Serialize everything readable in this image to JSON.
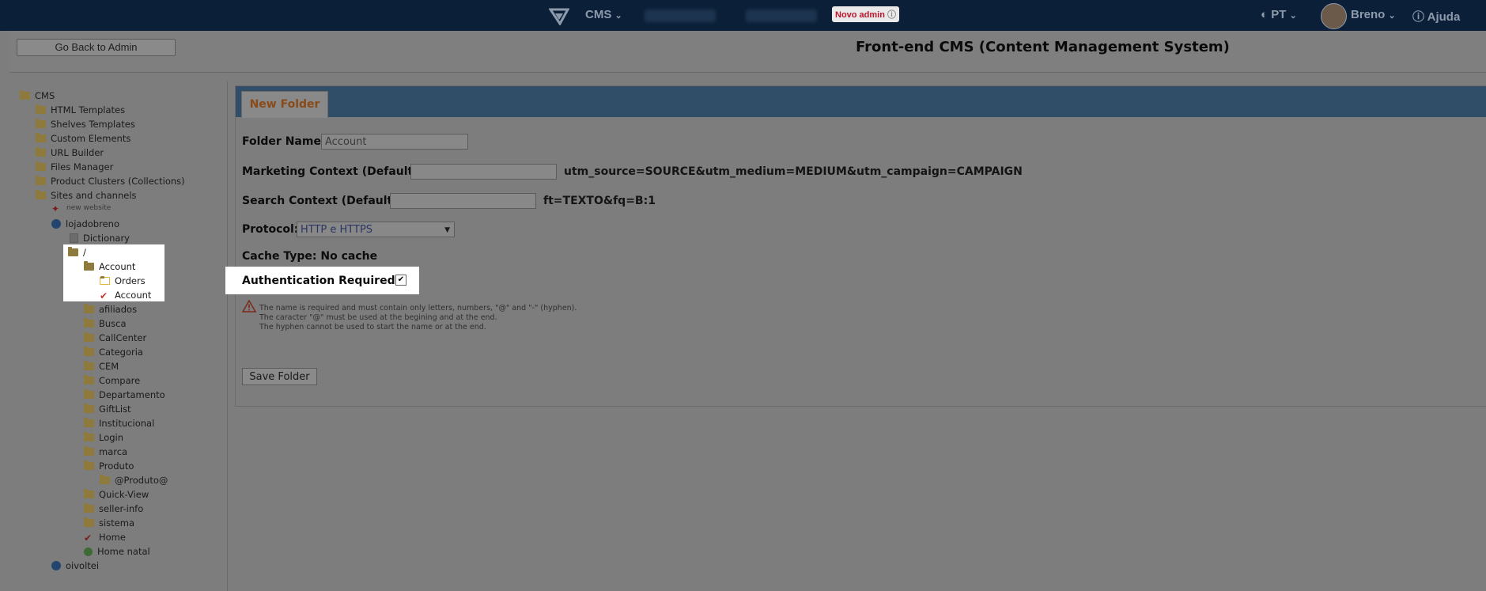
{
  "topbar": {
    "product": "CMS",
    "badge": "Novo admin",
    "language": "PT",
    "user": "Breno",
    "help": "Ajuda"
  },
  "header": {
    "back_button": "Go Back to Admin",
    "title": "Front-end CMS (Content Management System)"
  },
  "tree": {
    "root": "CMS",
    "items": [
      "HTML Templates",
      "Shelves Templates",
      "Custom Elements",
      "URL Builder",
      "Files Manager",
      "Product Clusters (Collections)",
      "Sites and channels",
      "new website",
      "lojadobreno",
      "Dictionary"
    ],
    "highlighted": [
      "/",
      "Account",
      "Orders",
      "Account"
    ],
    "folders": [
      "afiliados",
      "Busca",
      "CallCenter",
      "Categoria",
      "CEM",
      "Compare",
      "Departamento",
      "GiftList",
      "Institucional",
      "Login",
      "marca",
      "Produto"
    ],
    "produto_child": "@Produto@",
    "after": [
      "Quick-View",
      "seller-info",
      "sistema",
      "Home",
      "Home natal"
    ],
    "second_site": "oivoltei"
  },
  "form": {
    "tab": "New Folder",
    "folder_name_label": "Folder Name:",
    "folder_name_value": "Account",
    "marketing_label": "Marketing Context (Default):",
    "marketing_hint": "utm_source=SOURCE&utm_medium=MEDIUM&utm_campaign=CAMPAIGN",
    "search_label": "Search Context (Default):",
    "search_hint": "ft=TEXTO&fq=B:1",
    "protocol_label": "Protocol:",
    "protocol_value": "HTTP e HTTPS",
    "cache_label": "Cache Type: No cache",
    "auth_label": "Authentication Required?:",
    "auth_checked": true,
    "notes": [
      "The name is required and must contain only letters, numbers, \"@\" and \"-\" (hyphen).",
      "The caracter \"@\" must be used at the begining and at the end.",
      "The hyphen cannot be used to start the name or at the end."
    ],
    "save_button": "Save Folder"
  }
}
